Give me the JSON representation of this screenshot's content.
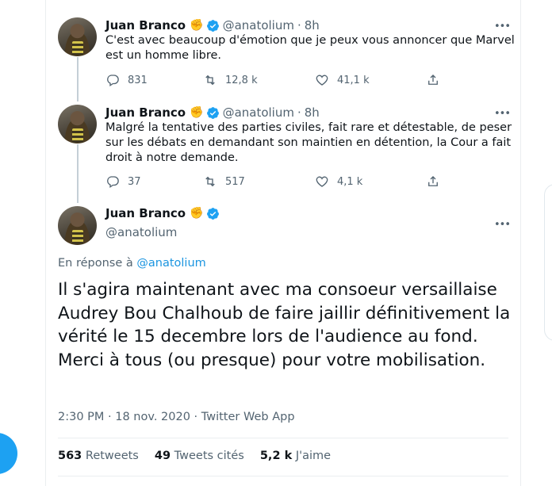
{
  "tweets": [
    {
      "name": "Juan Branco",
      "fist": "✊",
      "handle": "@anatolium",
      "sep": "·",
      "time": "8h",
      "more": "•••",
      "text": "C'est avec beaucoup d'émotion que je peux vous annoncer que Marvel est un homme libre.",
      "replies": "831",
      "retweets": "12,8 k",
      "likes": "41,1 k"
    },
    {
      "name": "Juan Branco",
      "fist": "✊",
      "handle": "@anatolium",
      "sep": "·",
      "time": "8h",
      "more": "•••",
      "text": "Malgré la tentative des parties civiles, fait rare et détestable, de peser sur les débats en demandant son maintien en détention, la Cour a fait droit à notre demande.",
      "replies": "37",
      "retweets": "517",
      "likes": "4,1 k"
    }
  ],
  "main": {
    "name": "Juan Branco",
    "fist": "✊",
    "handle": "@anatolium",
    "more": "•••",
    "reply_prefix": "En réponse à ",
    "reply_to": "@anatolium",
    "text": "Il s'agira maintenant avec ma consoeur versaillaise Audrey Bou Chalhoub de faire jaillir définitivement la vérité le 15 decembre lors de l'audience au fond. Merci à tous (ou presque) pour votre mobilisation.",
    "meta": "2:30 PM · 18 nov. 2020 · Twitter Web App",
    "stats": {
      "retweets_count": "563",
      "retweets_label": "Retweets",
      "quotes_count": "49",
      "quotes_label": "Tweets cités",
      "likes_count": "5,2 k",
      "likes_label": "J'aime"
    }
  },
  "colors": {
    "accent": "#1da1f2",
    "link": "#1b95e0",
    "verified": "#1da1f2",
    "secondary_text": "#536471"
  },
  "icons": [
    "reply-icon",
    "retweet-icon",
    "like-icon",
    "share-icon",
    "verified-badge-icon",
    "more-icon"
  ]
}
